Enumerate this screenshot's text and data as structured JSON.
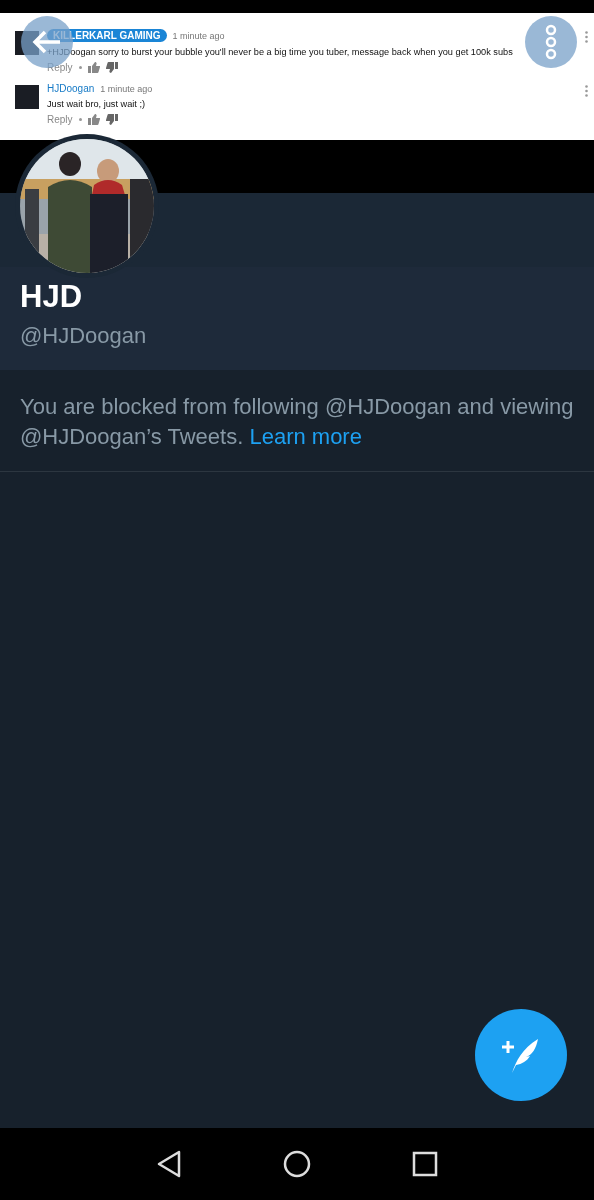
{
  "header_image": {
    "comments": [
      {
        "author": "KILLERKARL GAMING",
        "author_highlighted": true,
        "time": "1 minute ago",
        "text": "+HJDoogan sorry to burst your bubble you'll never be a big time you tuber, message back when you get 100k subs",
        "reply": "Reply"
      },
      {
        "author": "HJDoogan",
        "author_highlighted": false,
        "time": "1 minute ago",
        "text": "Just wait bro, just wait ;)",
        "reply": "Reply"
      }
    ]
  },
  "profile": {
    "name": "HJD",
    "handle": "@HJDoogan",
    "blocked_message": "You are blocked from following @HJDoogan and viewing @HJDoogan’s Tweets.",
    "learn_more": "Learn more"
  }
}
